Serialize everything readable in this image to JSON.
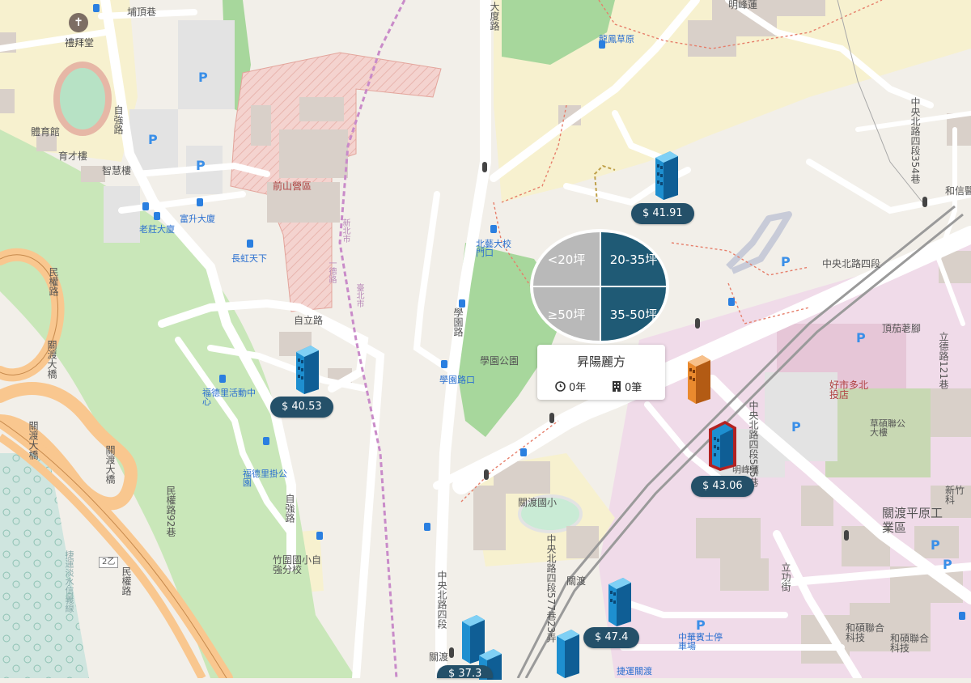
{
  "map": {
    "labels": {
      "church": "禮拜堂",
      "puding_lane": "埔頂巷",
      "zhiqiang_rd_top": "自強路",
      "gym": "體育館",
      "yucai": "育才樓",
      "zhihui": "智慧樓",
      "laozhuang": "老莊大廈",
      "fusheng": "富升大廈",
      "changhong": "長虹天下",
      "qianshan": "前山營區",
      "ziliroad": "自立路",
      "fude_center": "福德里活動中心",
      "fude_park": "福德里掛公園",
      "zhiqiang_rd_mid": "自強路",
      "zhuwei_school": "竹圍國小自強分校",
      "minquan_rd_92": "民權路92巷",
      "minquan_rd_left": "民權路",
      "guandu_bridge_1": "關渡大橋",
      "guandu_bridge_2": "關渡大橋",
      "guandu_bridge_3": "關渡大橋",
      "xueyuan_rd": "學園路",
      "xueyuan_park": "學園公園",
      "xueyuan_stop": "學園路口",
      "tnua_gate": "北藝大校門口",
      "longnine": "龍鳳草原",
      "gandu_rd": "大度路",
      "zhongyang_n4": "中央北路四段",
      "zhongyang_n4_right": "中央北路四段354巷",
      "heyu": "和信醫",
      "guandu_elem": "關渡國小",
      "zhongyang_n4_left": "中央北路四段",
      "zhongyang_n4_515": "中央北路四段515巷",
      "zhongyang_n4_577": "中央北路四段577巷23弄",
      "dingqie": "頂茄荖腳",
      "lide_rd": "立德路121巷",
      "rt_mart": "好市多北投店",
      "caoda": "草碩聯公大樓",
      "guandu_industrial": "關渡平原工業區",
      "xinzhu": "新竹科",
      "ligong_st": "立功街",
      "zhonghua": "中華賓士停車場",
      "heshuo_1": "和碩聯合科技",
      "heshuo_2": "和碩聯合科技",
      "jieyun": "捷運關渡",
      "guandu": "關渡",
      "guandu_stn": "關渡",
      "minquan_elev": "民權路",
      "danshui_line": "捷運淡水信義線",
      "ming": "明峰蓮",
      "road_2z": "2乙",
      "taipei_shi": "臺北市",
      "zhongyang_n": "中央北路四段",
      "xinbei": "新北市",
      "yidu": "一德路"
    },
    "parking": "P"
  },
  "listings": [
    {
      "price": "$ 41.91",
      "color": "#1e8fd0"
    },
    {
      "price": "$ 40.53",
      "color": "#1e8fd0"
    },
    {
      "price": "$ 43.06",
      "color": "#1e8fd0"
    },
    {
      "price": "$ 47.4",
      "color": "#1e8fd0"
    },
    {
      "price": "$ 37.3",
      "color": "#1e8fd0"
    }
  ],
  "size_filter": {
    "options": [
      {
        "label": "<20坪",
        "selected": false
      },
      {
        "label": "20-35坪",
        "selected": true
      },
      {
        "label": "≥50坪",
        "selected": false
      },
      {
        "label": "35-50坪",
        "selected": true
      }
    ],
    "selected_color": "#1f5a75",
    "unselected_color": "#b9b9b9"
  },
  "popup": {
    "title": "昇陽麗方",
    "age_value": "0年",
    "count_value": "0筆",
    "age_icon": "clock-icon",
    "count_icon": "building-icon"
  }
}
